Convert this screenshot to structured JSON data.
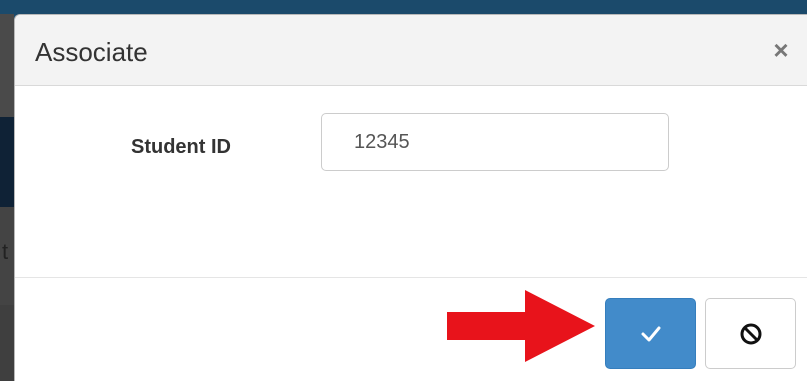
{
  "dialog": {
    "title": "Associate",
    "close_label": "×"
  },
  "form": {
    "student_id_label": "Student ID",
    "student_id_value": "12345"
  },
  "backdrop": {
    "partial_text": "t"
  },
  "buttons": {
    "confirm_icon": "check-icon",
    "cancel_icon": "ban-icon"
  },
  "colors": {
    "primary": "#428bca",
    "annotation_arrow": "#e8131b",
    "page_backdrop": "#1b4a6b"
  }
}
